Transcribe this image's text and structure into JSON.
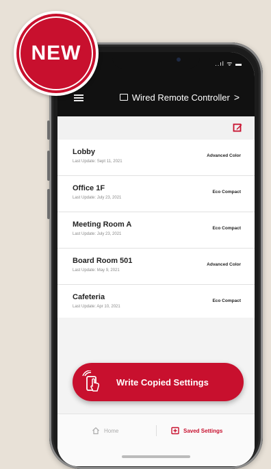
{
  "badge": {
    "label": "NEW"
  },
  "status": {
    "indicators": "..ıl ᯤ ▬"
  },
  "header": {
    "title": "Wired Remote Controller",
    "chevron": ">",
    "title_icon": "screen-icon"
  },
  "toolbar": {
    "edit_icon": "edit-icon"
  },
  "devices": [
    {
      "name": "Lobby",
      "updated": "Last Update: Sept 11, 2021",
      "model": "Advanced Color"
    },
    {
      "name": "Office 1F",
      "updated": "Last Update: July 23, 2021",
      "model": "Eco Compact"
    },
    {
      "name": "Meeting Room A",
      "updated": "Last Update: July 23, 2021",
      "model": "Eco Compact"
    },
    {
      "name": "Board Room 501",
      "updated": "Last Update: May 9, 2021",
      "model": "Advanced Color"
    },
    {
      "name": "Cafeteria",
      "updated": "Last Update: Apr 10, 2021",
      "model": "Eco Compact"
    }
  ],
  "action": {
    "label": "Write Copied Settings",
    "icon": "phone-tap-icon"
  },
  "nav": {
    "home": {
      "label": "Home",
      "icon": "home-icon"
    },
    "saved": {
      "label": "Saved Settings",
      "icon": "saved-settings-icon"
    }
  },
  "colors": {
    "accent": "#c8102e",
    "topbar": "#111111",
    "background": "#e8e1d7"
  }
}
